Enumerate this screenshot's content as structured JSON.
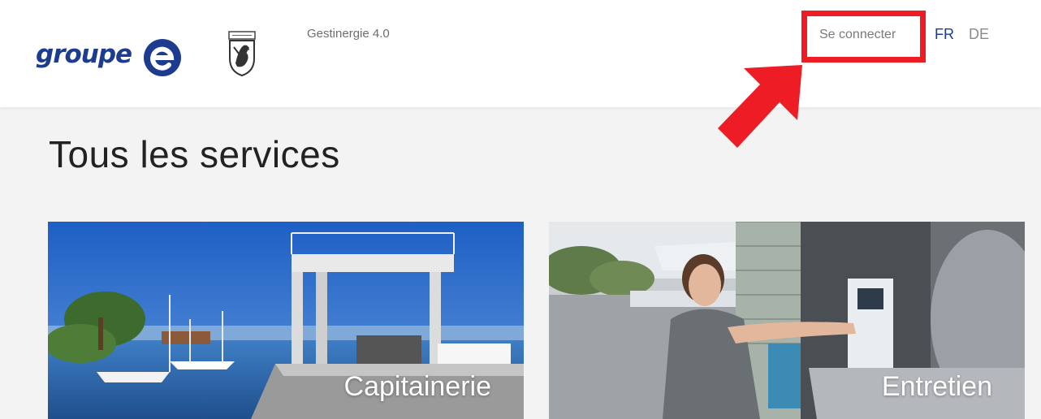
{
  "header": {
    "brand_word": "groupe",
    "app_name": "Gestinergie 4.0",
    "login_label": "Se connecter",
    "languages": [
      {
        "code": "FR",
        "active": true
      },
      {
        "code": "DE",
        "active": false
      }
    ]
  },
  "main": {
    "title": "Tous les services",
    "cards": [
      {
        "label": "Capitainerie"
      },
      {
        "label": "Entretien"
      }
    ]
  },
  "colors": {
    "brand_blue": "#1d3c8f",
    "highlight_red": "#ee1c24",
    "page_bg": "#f3f3f3"
  },
  "icons": [
    "groupe-e-logo-icon",
    "commune-crest-icon",
    "red-arrow-icon"
  ]
}
